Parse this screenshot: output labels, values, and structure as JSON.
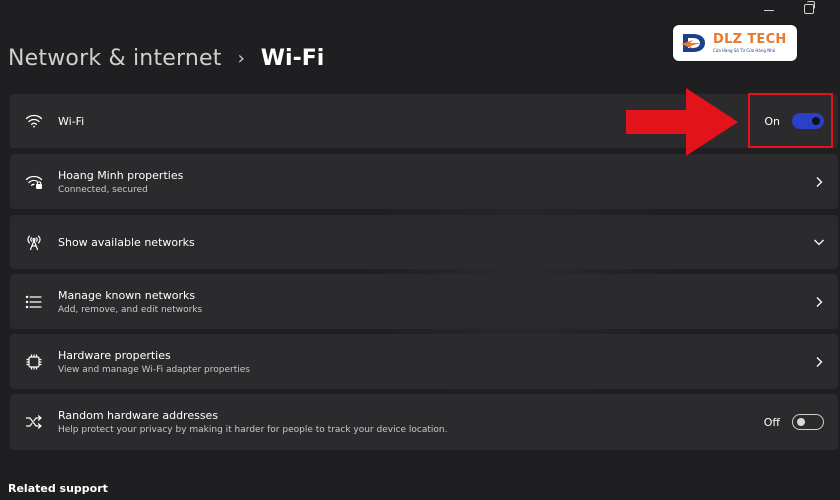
{
  "breadcrumb": {
    "parent": "Network & internet",
    "separator": "›",
    "current": "Wi-Fi"
  },
  "logo": {
    "name": "DLZ TECH",
    "tagline": "Cửa Hàng Số Từ Cửa Hàng Nhỏ"
  },
  "rows": [
    {
      "id": "wifi",
      "title": "Wi-Fi",
      "icon": "wifi-icon",
      "control": "toggle",
      "state": "On"
    },
    {
      "id": "properties",
      "title": "Hoang Minh properties",
      "subtitle": "Connected, secured",
      "icon": "wifi-secured-icon",
      "control": "chevron-right"
    },
    {
      "id": "available",
      "title": "Show available networks",
      "icon": "antenna-icon",
      "control": "chevron-down"
    },
    {
      "id": "known",
      "title": "Manage known networks",
      "subtitle": "Add, remove, and edit networks",
      "icon": "list-icon",
      "control": "chevron-right"
    },
    {
      "id": "hardware",
      "title": "Hardware properties",
      "subtitle": "View and manage Wi-Fi adapter properties",
      "icon": "chip-icon",
      "control": "chevron-right"
    },
    {
      "id": "random",
      "title": "Random hardware addresses",
      "subtitle": "Help protect your privacy by making it harder for people to track your device location.",
      "icon": "shuffle-icon",
      "control": "toggle",
      "state": "Off"
    }
  ],
  "footer": {
    "related_support": "Related support"
  },
  "colors": {
    "background": "#1f1f21",
    "card": "#2b2b2d",
    "accent": "#2a40c8",
    "annotation": "#e3131b",
    "logo_orange": "#e8792a",
    "logo_blue": "#1d3f8c"
  }
}
